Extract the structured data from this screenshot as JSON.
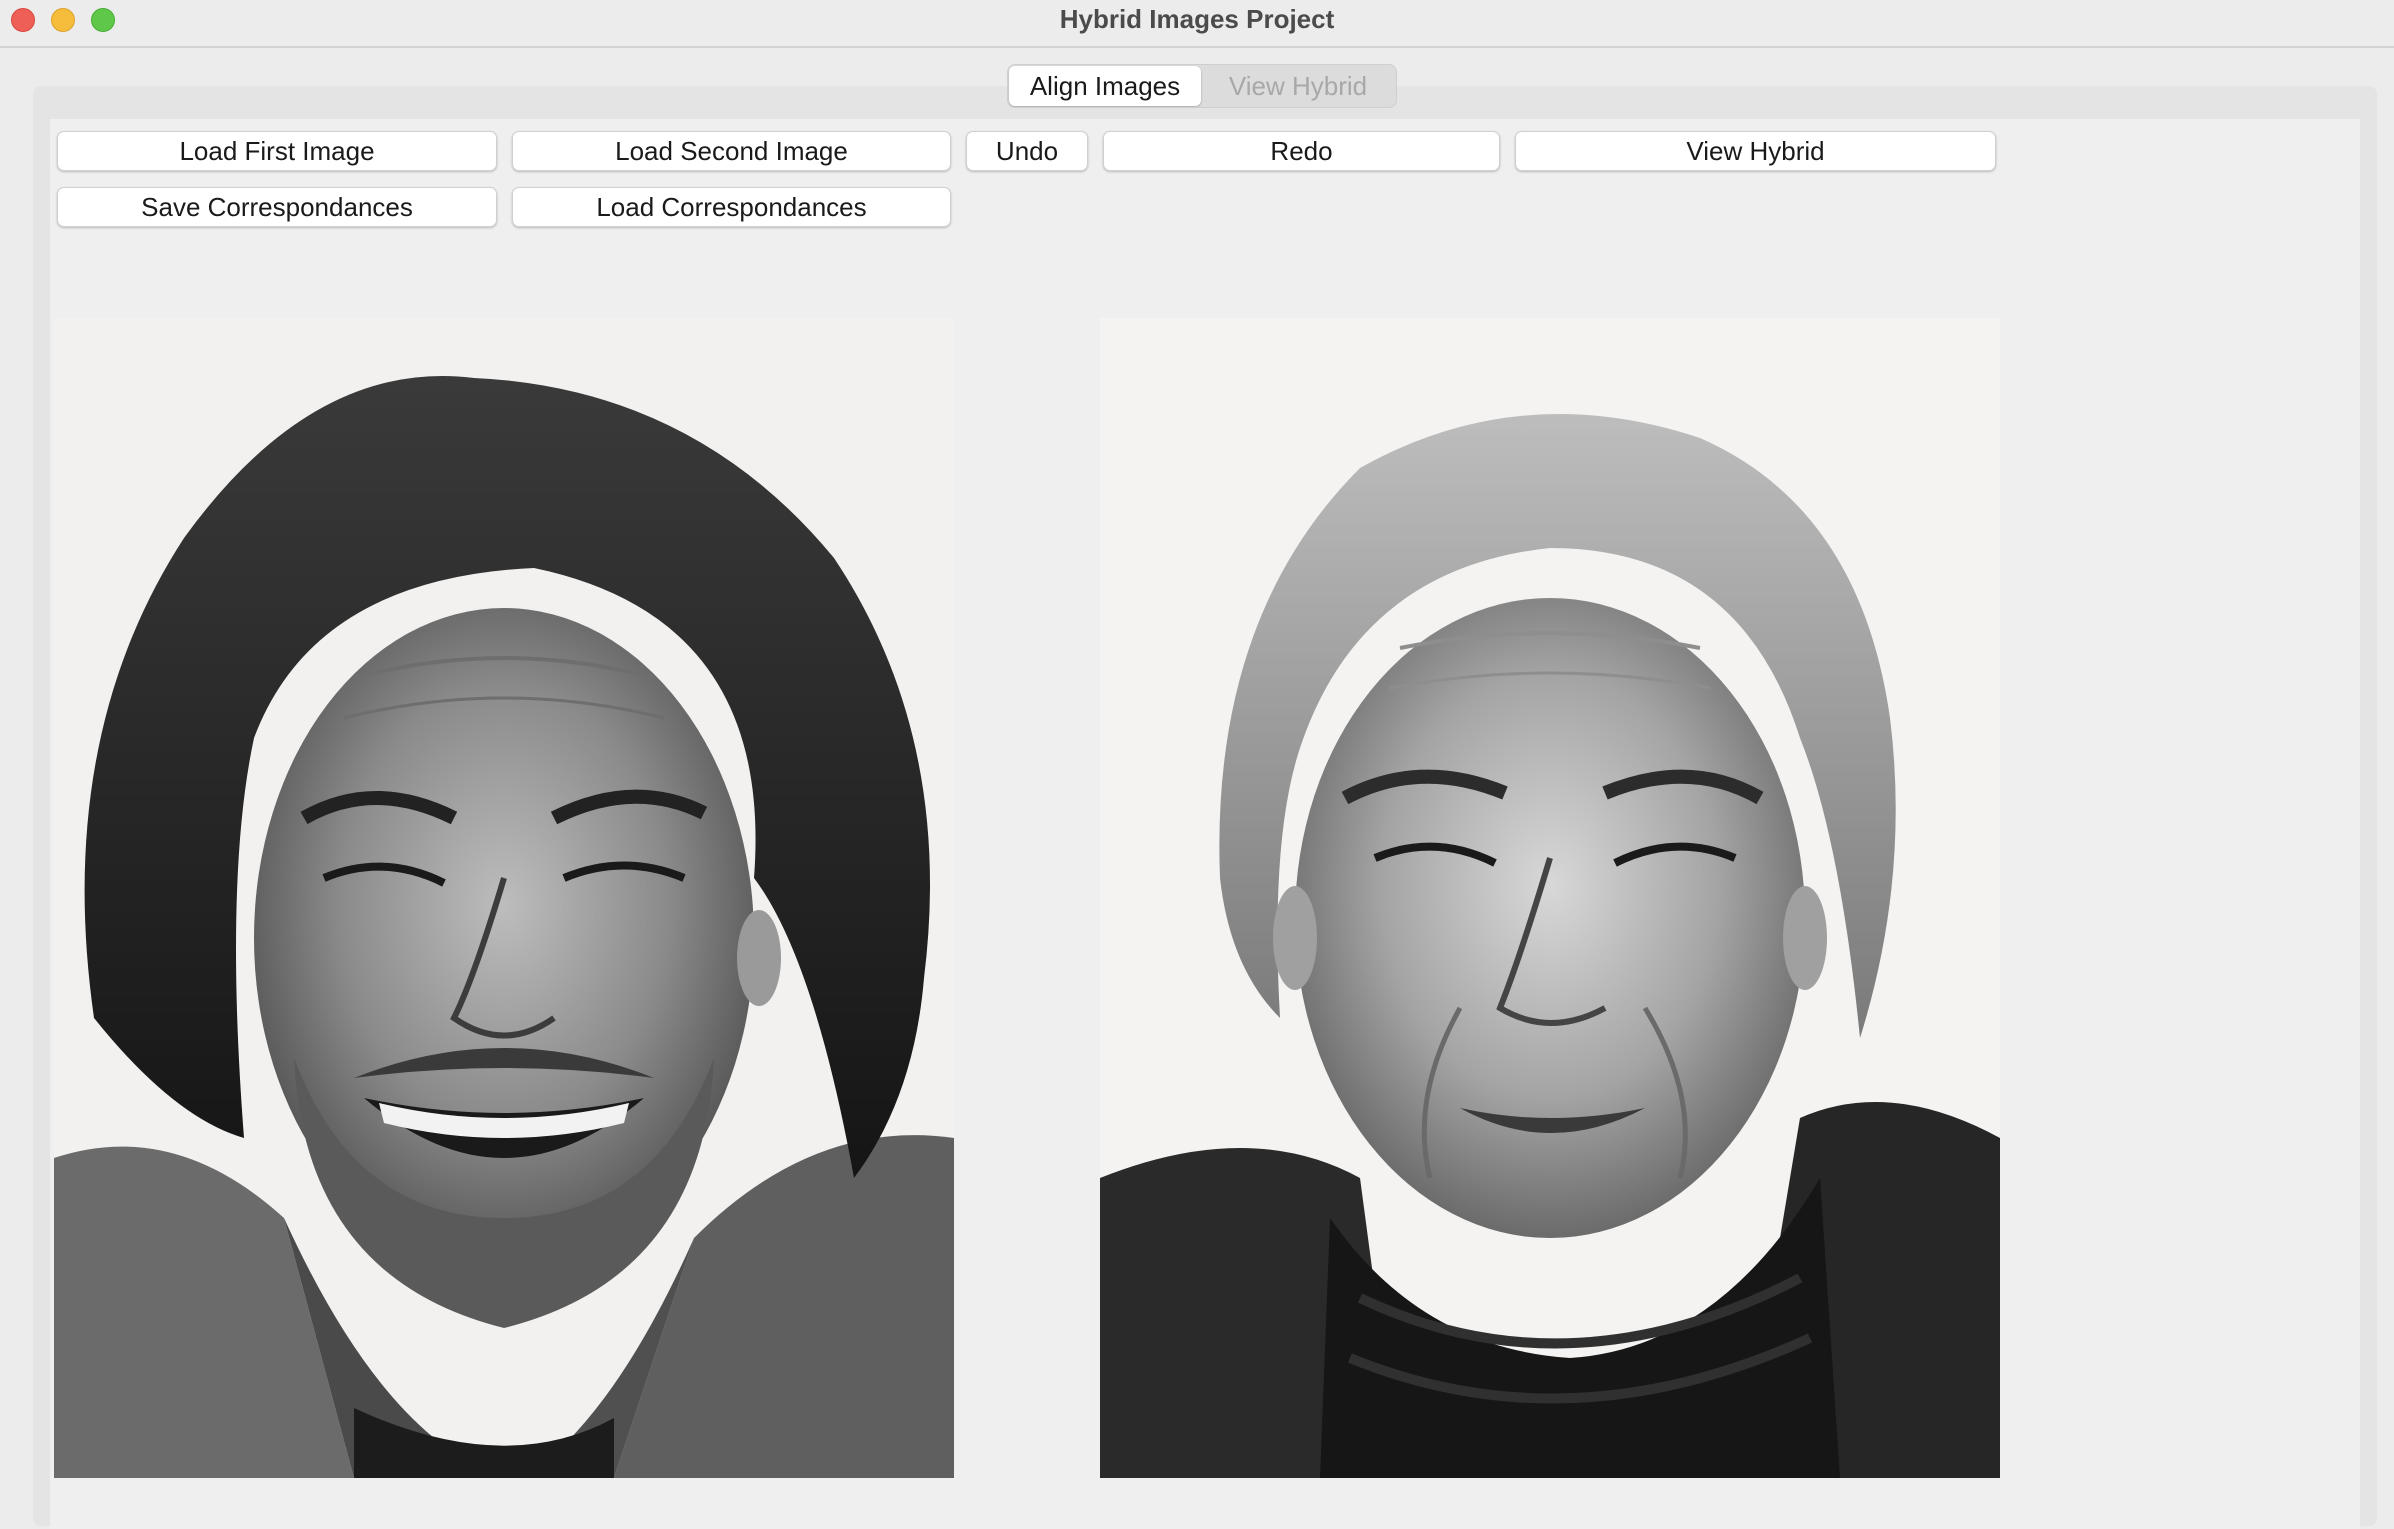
{
  "window": {
    "title": "Hybrid Images Project"
  },
  "tabs": [
    {
      "label": "Align Images",
      "active": true
    },
    {
      "label": "View Hybrid",
      "active": false
    }
  ],
  "toolbar": {
    "load_first_image": "Load First Image",
    "load_second_image": "Load Second Image",
    "undo": "Undo",
    "redo": "Redo",
    "view_hybrid": "View Hybrid",
    "save_correspondances": "Save Correspondances",
    "load_correspondances": "Load Correspondances"
  },
  "images": [
    {
      "name": "first-image",
      "content": "black-and-white portrait, laughing man with long grey hair and beard"
    },
    {
      "name": "second-image",
      "content": "black-and-white portrait, smiling older man with swept-back grey hair and turtleneck"
    }
  ],
  "colors": {
    "window_bg": "#ececec",
    "close": "#ee5f57",
    "minimize": "#f6bd3c",
    "maximize": "#5fc84a"
  }
}
